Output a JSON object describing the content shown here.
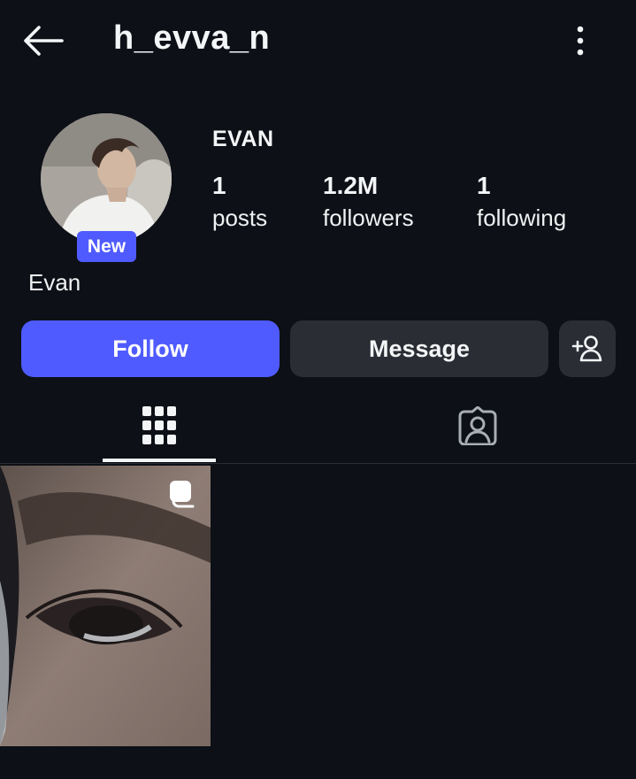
{
  "header": {
    "username": "h_evva_n",
    "back_icon": "arrow-left-icon",
    "more_icon": "more-vertical-icon"
  },
  "profile": {
    "display_name_upper": "EVAN",
    "badge": "New",
    "bio_name": "Evan",
    "stats": {
      "posts": {
        "value": "1",
        "label": "posts"
      },
      "followers": {
        "value": "1.2M",
        "label": "followers"
      },
      "following": {
        "value": "1",
        "label": "following"
      }
    }
  },
  "actions": {
    "follow_label": "Follow",
    "message_label": "Message",
    "add_user_icon": "add-user-icon"
  },
  "tabs": [
    {
      "name": "posts-grid",
      "icon": "grid-icon",
      "active": true
    },
    {
      "name": "tagged",
      "icon": "tagged-person-icon",
      "active": false
    }
  ],
  "posts": [
    {
      "type": "carousel",
      "icon": "multiple-images-icon"
    }
  ],
  "colors": {
    "background": "#0d1016",
    "accent": "#4f5bff",
    "secondary_button": "#2a2d33",
    "text": "#f4f5f7"
  }
}
